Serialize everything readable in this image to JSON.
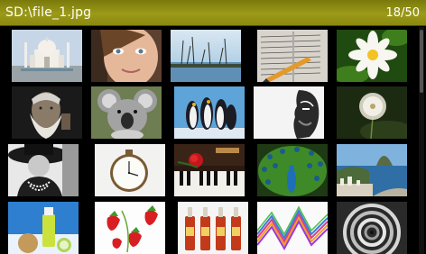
{
  "header": {
    "title": "SD:\\file_1.jpg",
    "counter": "18/50"
  },
  "colors": {
    "title_bar": "#9c9a18",
    "background": "#000000",
    "title_text": "#ffffff"
  },
  "thumbnails": [
    {
      "name": "taj-mahal"
    },
    {
      "name": "girl-face"
    },
    {
      "name": "lake-reeds"
    },
    {
      "name": "pen-on-book"
    },
    {
      "name": "white-flower"
    },
    {
      "name": "old-man"
    },
    {
      "name": "koala"
    },
    {
      "name": "penguins"
    },
    {
      "name": "man-profile"
    },
    {
      "name": "dandelion"
    },
    {
      "name": "woman-hat"
    },
    {
      "name": "pocket-watch"
    },
    {
      "name": "piano-rose"
    },
    {
      "name": "peacock"
    },
    {
      "name": "bay-coast"
    },
    {
      "name": "juice-fruits"
    },
    {
      "name": "strawberries"
    },
    {
      "name": "sauce-bottles"
    },
    {
      "name": "color-waves"
    },
    {
      "name": "spiral-steps"
    }
  ]
}
